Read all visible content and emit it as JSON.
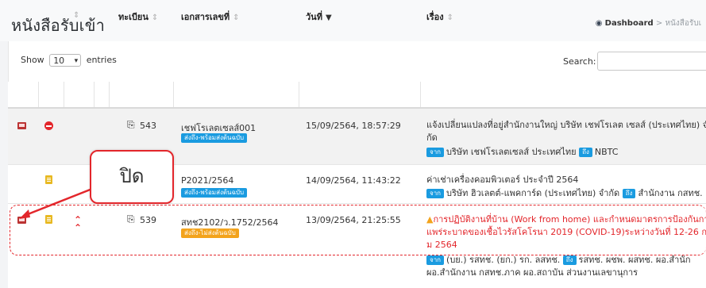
{
  "page": {
    "title": "หนังสือรับเข้า",
    "breadcrumb": {
      "home": "Dashboard",
      "separator": ">",
      "current": "หนังสือรับเ"
    }
  },
  "table_controls": {
    "show_label": "Show",
    "entries_value": "10",
    "entries_label": "entries",
    "search_label": "Search:"
  },
  "columns": {
    "reg_no": "ทะเบียน",
    "doc_no": "เอกสารเลขที่",
    "date": "วันที่",
    "subject": "เรื่อง"
  },
  "rows": [
    {
      "reg_no": "543",
      "doc_no": "เชฟโรเลตเซลส์001",
      "status": "ส่งถึง-พร้อมส่งต้นฉบับ",
      "date": "15/09/2564, 18:57:29",
      "subject_line1": "แจ้งเปลี่ยนแปลงที่อยู่สำนักงานใหญ่ บริษัท เชฟโรเลต เซลส์ (ประเทศไทย) จำ",
      "subject_line2": "กัด",
      "from_tag": "จาก",
      "from": "บริษัท เชฟโรเลตเซลส์ ประเทศไทย",
      "to_tag": "ถึง",
      "to": "NBTC"
    },
    {
      "reg_no": "",
      "doc_no": "P2021/2564",
      "status": "ส่งถึง-พร้อมส่งต้นฉบับ",
      "date": "14/09/2564, 11:43:22",
      "subject_line1": "ค่าเช่าเครื่องคอมพิวเตอร์ ประจำปี 2564",
      "from_tag": "จาก",
      "from": "บริษัท ฮิวเลตต์-แพคการ์ด (ประเทศไทย) จำกัด",
      "to_tag": "ถึง",
      "to": "สำนักงาน กสทช."
    },
    {
      "reg_no": "539",
      "doc_no": "สทช2102/ว.1752/2564",
      "status": "ส่งถึง-ไม่ส่งต้นฉบับ",
      "date": "13/09/2564, 21:25:55",
      "subject_line1": "การปฏิบัติงานที่บ้าน (Work from home) และกำหนดมาตรการป้องกันการ",
      "subject_line2": "แพร่ระบาดของเชื้อไวรัสโคโรนา 2019 (COVID-19)ระหว่างวันที่ 12-26 กรกฎา",
      "subject_line3": "ม 2564",
      "from_tag": "จาก",
      "from": "(บย.) รสทช. (ยก.) รก. ลสทช.",
      "to_tag": "ถึง",
      "to": "รสทช. ผชพ. ผสทช. ผอ.สำนัก",
      "to_line2": "ผอ.สำนักงาน กสทช.ภาค ผอ.สถาบัน ส่วนงานเลขานุการ"
    }
  ],
  "callout": {
    "text": "ปิด"
  },
  "colors": {
    "badge_blue": "#1a9be0",
    "badge_orange": "#f3a31c",
    "alert_red": "#e3262b"
  }
}
